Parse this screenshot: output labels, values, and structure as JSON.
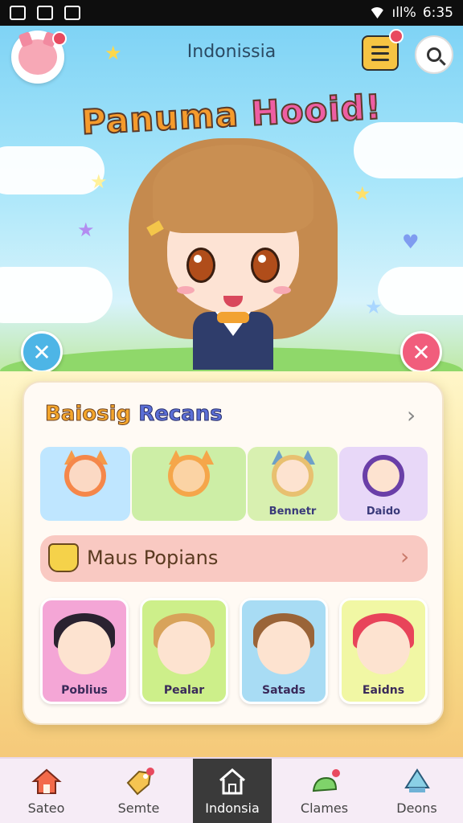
{
  "status_bar": {
    "time": "6:35",
    "battery": "ıll%"
  },
  "header": {
    "title": "Indonissia",
    "headline_part1": "Panuma ",
    "headline_part2": "Hooid!"
  },
  "recent": {
    "title_part1": "Baiosig ",
    "title_part2": "Recans",
    "items": [
      {
        "label": ""
      },
      {
        "label": ""
      },
      {
        "label": "Bennetr"
      },
      {
        "label": "Daido"
      }
    ]
  },
  "banner": {
    "label": "Maus Popians"
  },
  "popular": {
    "items": [
      {
        "label": "Poblius"
      },
      {
        "label": "Pealar"
      },
      {
        "label": "Satads"
      },
      {
        "label": "Eaidns"
      }
    ]
  },
  "bottom_nav": [
    {
      "label": "Sateo"
    },
    {
      "label": "Semte"
    },
    {
      "label": "Indonsia"
    },
    {
      "label": "Clames"
    },
    {
      "label": "Deons"
    }
  ],
  "colors": {
    "accent_pink": "#f15d7c",
    "accent_blue": "#4db5e6",
    "nav_active": "#3a3a3a"
  }
}
